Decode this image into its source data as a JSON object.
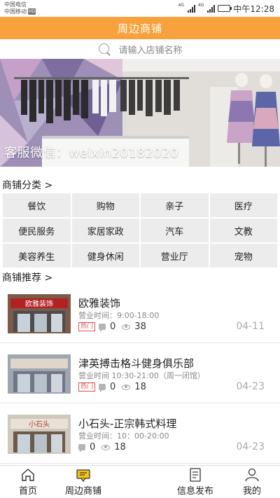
{
  "status_bar": {
    "carrier1": "中国电信",
    "carrier2": "中国移动",
    "carrier2_badge": "HD",
    "signal1_label": "4G",
    "signal2_label": "4G",
    "battery_level": 0.7,
    "time": "中午12:28"
  },
  "header": {
    "title": "周边商铺"
  },
  "search": {
    "placeholder": "请输入店铺名称"
  },
  "banner": {
    "text": "客服微信：weixin20182020"
  },
  "categories_section": {
    "title": "商铺分类 >",
    "items": [
      "餐饮",
      "购物",
      "亲子",
      "医疗",
      "便民服务",
      "家居家政",
      "汽车",
      "文教",
      "美容养生",
      "健身休闲",
      "营业厅",
      "宠物"
    ]
  },
  "recommend_section": {
    "title": "商铺推荐 >",
    "shops": [
      {
        "name": "欧雅装饰",
        "hours": "营业时间：9:00-18:00",
        "hot": "热门",
        "comments": "0",
        "views": "38",
        "date": "04-11",
        "thumb_sign": "欧雅装饰"
      },
      {
        "name": "津英搏击格斗健身俱乐部",
        "hours": "营业时间 10:30-21:00（周一闭馆）",
        "hot": "热门",
        "comments": "0",
        "views": "18",
        "date": "04-23",
        "thumb_sign": ""
      },
      {
        "name": "小石头-正宗韩式料理",
        "hours": "营业时间：10：00-20:00",
        "hot": "",
        "comments": "0",
        "views": "18",
        "date": "04-23",
        "thumb_sign": "小石头"
      }
    ]
  },
  "tabbar": {
    "home": "首页",
    "nearby": "周边商铺",
    "publish": "信息发布",
    "mine": "我的"
  },
  "colors": {
    "accent": "#f7a23c",
    "add_button": "#3ec6c5",
    "hot": "#d9534f"
  }
}
